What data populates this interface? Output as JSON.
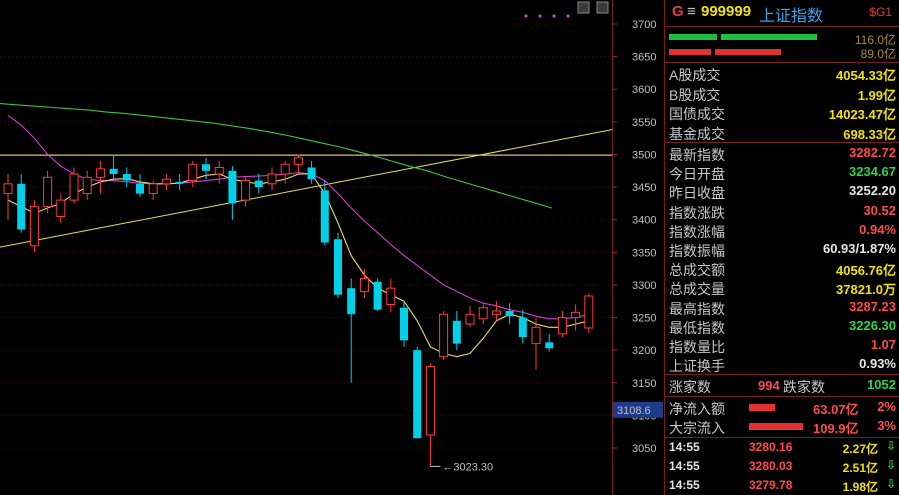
{
  "header": {
    "market_flag": "G",
    "menu_icon": "hamburger-icon",
    "code": "999999",
    "name": "上证指数",
    "tag": "$G1"
  },
  "breadth_bars": {
    "up_label": "116.0亿",
    "down_label": "89.0亿",
    "colors": {
      "up": "#1fbf3c",
      "down": "#e03030"
    }
  },
  "turnover": [
    {
      "label": "A股成交",
      "value": "4054.33亿",
      "color": "yellow"
    },
    {
      "label": "B股成交",
      "value": "1.99亿",
      "color": "yellow"
    },
    {
      "label": "国债成交",
      "value": "14023.47亿",
      "color": "yellow"
    },
    {
      "label": "基金成交",
      "value": "698.33亿",
      "color": "yellow"
    }
  ],
  "stats": [
    {
      "label": "最新指数",
      "value": "3282.72",
      "color": "red"
    },
    {
      "label": "今日开盘",
      "value": "3234.67",
      "color": "green"
    },
    {
      "label": "昨日收盘",
      "value": "3252.20",
      "color": "white"
    },
    {
      "label": "指数涨跌",
      "value": "30.52",
      "color": "red"
    },
    {
      "label": "指数涨幅",
      "value": "0.94%",
      "color": "red"
    },
    {
      "label": "指数振幅",
      "value": "60.93/1.87%",
      "color": "white"
    },
    {
      "label": "总成交额",
      "value": "4056.76亿",
      "color": "yellow"
    },
    {
      "label": "总成交量",
      "value": "37821.0万",
      "color": "yellow"
    },
    {
      "label": "最高指数",
      "value": "3287.23",
      "color": "red"
    },
    {
      "label": "最低指数",
      "value": "3226.30",
      "color": "green"
    },
    {
      "label": "指数量比",
      "value": "1.07",
      "color": "red"
    },
    {
      "label": "上证换手",
      "value": "0.93%",
      "color": "white"
    }
  ],
  "breadth": {
    "up_label": "涨家数",
    "up_value": "994",
    "down_label": "跌家数",
    "down_value": "1052"
  },
  "flows": [
    {
      "label": "净流入额",
      "value": "63.07亿",
      "pct": "2%"
    },
    {
      "label": "大宗流入",
      "value": "109.9亿",
      "pct": "3%"
    }
  ],
  "ticks": [
    {
      "time": "14:55",
      "price": "3280.16",
      "vol": "2.27亿",
      "icon": "down-arrow-icon"
    },
    {
      "time": "14:55",
      "price": "3280.03",
      "vol": "2.51亿",
      "icon": "down-arrow-icon"
    },
    {
      "time": "14:55",
      "price": "3279.78",
      "vol": "1.98亿",
      "icon": "down-arrow-icon"
    }
  ],
  "chart_data": {
    "type": "candlestick",
    "y_ticks": [
      3700,
      3650,
      3600,
      3550,
      3500,
      3450,
      3400,
      3350,
      3300,
      3250,
      3200,
      3150,
      3100,
      3050
    ],
    "ylim": [
      3025,
      3720
    ],
    "current_price_label": "3108.6",
    "low_annotation": "3023.30",
    "low_value": 3023.3,
    "horizontal_line": 3499,
    "trendline": {
      "from": [
        0,
        3358
      ],
      "to": [
        44,
        3538
      ]
    },
    "candles": [
      {
        "o": 3440,
        "h": 3470,
        "l": 3400,
        "c": 3455
      },
      {
        "o": 3455,
        "h": 3470,
        "l": 3380,
        "c": 3385
      },
      {
        "o": 3360,
        "h": 3430,
        "l": 3350,
        "c": 3420
      },
      {
        "o": 3420,
        "h": 3475,
        "l": 3410,
        "c": 3465
      },
      {
        "o": 3405,
        "h": 3440,
        "l": 3395,
        "c": 3430
      },
      {
        "o": 3430,
        "h": 3480,
        "l": 3425,
        "c": 3470
      },
      {
        "o": 3440,
        "h": 3475,
        "l": 3430,
        "c": 3465
      },
      {
        "o": 3465,
        "h": 3490,
        "l": 3440,
        "c": 3478
      },
      {
        "o": 3478,
        "h": 3500,
        "l": 3460,
        "c": 3470
      },
      {
        "o": 3470,
        "h": 3480,
        "l": 3450,
        "c": 3460
      },
      {
        "o": 3455,
        "h": 3470,
        "l": 3435,
        "c": 3440
      },
      {
        "o": 3440,
        "h": 3460,
        "l": 3430,
        "c": 3455
      },
      {
        "o": 3455,
        "h": 3470,
        "l": 3445,
        "c": 3462
      },
      {
        "o": 3458,
        "h": 3470,
        "l": 3445,
        "c": 3455
      },
      {
        "o": 3460,
        "h": 3490,
        "l": 3450,
        "c": 3485
      },
      {
        "o": 3485,
        "h": 3495,
        "l": 3462,
        "c": 3475
      },
      {
        "o": 3470,
        "h": 3490,
        "l": 3455,
        "c": 3480
      },
      {
        "o": 3475,
        "h": 3482,
        "l": 3400,
        "c": 3425
      },
      {
        "o": 3430,
        "h": 3465,
        "l": 3420,
        "c": 3460
      },
      {
        "o": 3460,
        "h": 3470,
        "l": 3440,
        "c": 3450
      },
      {
        "o": 3455,
        "h": 3480,
        "l": 3445,
        "c": 3470
      },
      {
        "o": 3470,
        "h": 3490,
        "l": 3455,
        "c": 3485
      },
      {
        "o": 3485,
        "h": 3500,
        "l": 3470,
        "c": 3495
      },
      {
        "o": 3480,
        "h": 3490,
        "l": 3455,
        "c": 3462
      },
      {
        "o": 3445,
        "h": 3460,
        "l": 3360,
        "c": 3365
      },
      {
        "o": 3370,
        "h": 3380,
        "l": 3280,
        "c": 3285
      },
      {
        "o": 3295,
        "h": 3310,
        "l": 3150,
        "c": 3255
      },
      {
        "o": 3290,
        "h": 3325,
        "l": 3280,
        "c": 3310
      },
      {
        "o": 3305,
        "h": 3310,
        "l": 3260,
        "c": 3262
      },
      {
        "o": 3270,
        "h": 3310,
        "l": 3258,
        "c": 3295
      },
      {
        "o": 3265,
        "h": 3275,
        "l": 3205,
        "c": 3215
      },
      {
        "o": 3200,
        "h": 3205,
        "l": 3065,
        "c": 3065
      },
      {
        "o": 3070,
        "h": 3180,
        "l": 3023,
        "c": 3175
      },
      {
        "o": 3190,
        "h": 3260,
        "l": 3185,
        "c": 3255
      },
      {
        "o": 3245,
        "h": 3260,
        "l": 3200,
        "c": 3210
      },
      {
        "o": 3240,
        "h": 3268,
        "l": 3235,
        "c": 3255
      },
      {
        "o": 3248,
        "h": 3270,
        "l": 3240,
        "c": 3265
      },
      {
        "o": 3255,
        "h": 3275,
        "l": 3245,
        "c": 3260
      },
      {
        "o": 3260,
        "h": 3272,
        "l": 3240,
        "c": 3252
      },
      {
        "o": 3250,
        "h": 3262,
        "l": 3210,
        "c": 3220
      },
      {
        "o": 3210,
        "h": 3250,
        "l": 3170,
        "c": 3235
      },
      {
        "o": 3212,
        "h": 3225,
        "l": 3198,
        "c": 3203
      },
      {
        "o": 3225,
        "h": 3260,
        "l": 3220,
        "c": 3250
      },
      {
        "o": 3250,
        "h": 3270,
        "l": 3230,
        "c": 3258
      },
      {
        "o": 3234,
        "h": 3287,
        "l": 3226,
        "c": 3283
      }
    ],
    "ma_fast": [
      3430,
      3420,
      3410,
      3418,
      3425,
      3440,
      3450,
      3458,
      3462,
      3463,
      3458,
      3455,
      3455,
      3456,
      3462,
      3468,
      3470,
      3462,
      3458,
      3455,
      3458,
      3462,
      3470,
      3470,
      3440,
      3395,
      3345,
      3315,
      3295,
      3285,
      3275,
      3245,
      3205,
      3195,
      3190,
      3195,
      3218,
      3245,
      3255,
      3250,
      3240,
      3235,
      3235,
      3240,
      3245
    ],
    "ma_mid": [
      3560,
      3545,
      3525,
      3500,
      3482,
      3470,
      3462,
      3460,
      3460,
      3458,
      3456,
      3455,
      3455,
      3456,
      3458,
      3460,
      3462,
      3465,
      3466,
      3467,
      3468,
      3470,
      3472,
      3470,
      3460,
      3440,
      3418,
      3398,
      3380,
      3362,
      3345,
      3330,
      3315,
      3300,
      3290,
      3280,
      3272,
      3268,
      3262,
      3258,
      3252,
      3248,
      3248,
      3250,
      3255
    ],
    "ma_slow": [
      3578,
      3576,
      3574,
      3572,
      3570,
      3568,
      3565,
      3563,
      3560,
      3557,
      3554,
      3551,
      3548,
      3544,
      3540,
      3535,
      3530,
      3524,
      3518,
      3512,
      3505,
      3498,
      3490,
      3482,
      3475,
      3466,
      3458,
      3450,
      3442,
      3434,
      3426,
      3418
    ],
    "colors": {
      "up": "#ff3b3b",
      "down": "#00d0e8",
      "ma_fast": "#e6e060",
      "ma_mid": "#d23fd2",
      "ma_slow": "#3ec43e",
      "hline": "#f5f5a0",
      "trend": "#e6e060"
    }
  }
}
